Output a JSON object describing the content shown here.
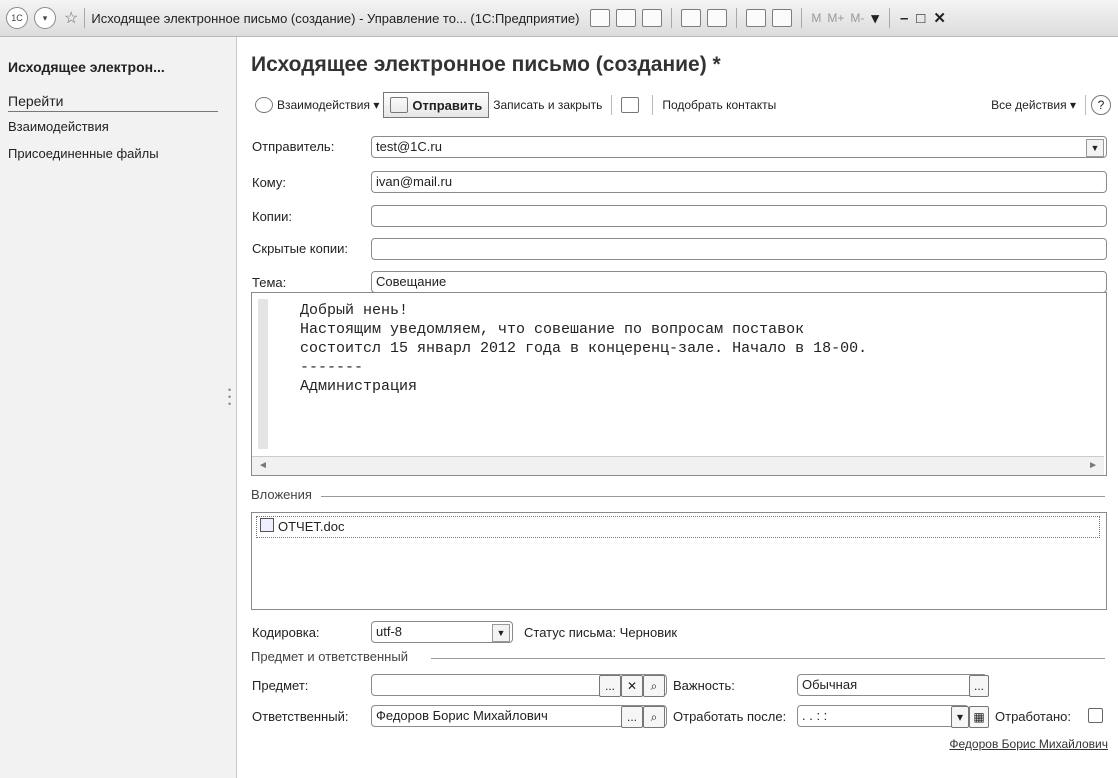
{
  "titlebar": {
    "title": "Исходящее электронное письмо (создание) - Управление то...  (1С:Предприятие)",
    "mem": [
      "M",
      "M+",
      "M-"
    ]
  },
  "left": {
    "title": "Исходящее электрон...",
    "goto": "Перейти",
    "links": [
      "Взаимодействия",
      "Присоединенные файлы"
    ]
  },
  "form": {
    "title": "Исходящее электронное письмо (создание) *",
    "toolbar": {
      "interactions": "Взаимодействия",
      "send": "Отправить",
      "save_close": "Записать и закрыть",
      "pick_contacts": "Подобрать контакты",
      "all_actions": "Все действия",
      "help": "?"
    },
    "fields": {
      "sender_label": "Отправитель:",
      "sender": "test@1C.ru",
      "to_label": "Кому:",
      "to": "ivan@mail.ru",
      "cc_label": "Копии:",
      "cc": "",
      "bcc_label": "Скрытые копии:",
      "bcc": "",
      "subject_label": "Тема:",
      "subject": "Совещание"
    },
    "body": [
      "Добрый нень!",
      "Настоящим уведомляем, что совешание по вопросам поставок",
      "состоитсл 15 январл 2012 года в концеренц-зале. Начало в 18-00.",
      "-------",
      "Администрация"
    ],
    "attachments_label": "Вложения",
    "attachments": [
      "ОТЧЕТ.doc"
    ],
    "encoding_label": "Кодировка:",
    "encoding": "utf-8",
    "status": "Статус письма: Черновик",
    "group_label": "Предмет и ответственный",
    "subject2_label": "Предмет:",
    "subject2": "",
    "importance_label": "Важность:",
    "importance": "Обычная",
    "responsible_label": "Ответственный:",
    "responsible": "Федоров Борис Михайлович",
    "process_after_label": "Отработать после:",
    "process_after": ". .   : :",
    "processed_label": "Отработано:",
    "author_link": "Федоров Борис Михайлович"
  }
}
